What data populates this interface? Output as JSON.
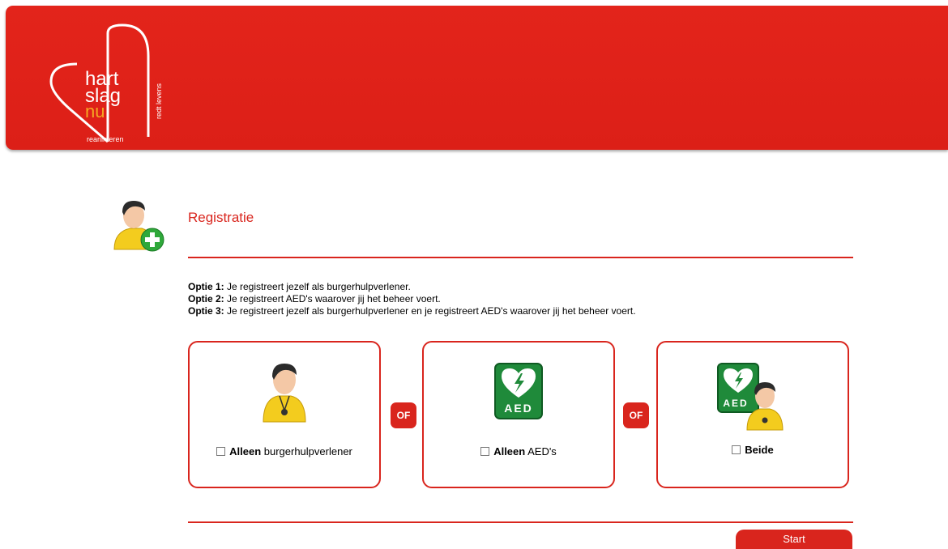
{
  "brand": {
    "logo_line1": "hart",
    "logo_line2": "slag",
    "logo_line3": "nu",
    "logo_sub": "reanimeren",
    "logo_side": "redt levens"
  },
  "page": {
    "title": "Registratie"
  },
  "options": [
    {
      "label": "Optie 1:",
      "text": " Je registreert jezelf als burgerhulpverlener."
    },
    {
      "label": "Optie 2:",
      "text": " Je registreert AED's waarover jij het beheer voert."
    },
    {
      "label": "Optie 3:",
      "text": " Je registreert jezelf als burgerhulpverlener en je registreert AED's waarover jij het beheer voert."
    }
  ],
  "cards": [
    {
      "bold": "Alleen",
      "rest": " burgerhulpverlener",
      "icon": "person-icon"
    },
    {
      "bold": "Alleen",
      "rest": " AED's",
      "icon": "aed-icon"
    },
    {
      "bold": "Beide",
      "rest": "",
      "icon": "aed-person-icon"
    }
  ],
  "separator": "OF",
  "aed_label": "AED",
  "start_label": "Start",
  "colors": {
    "brand_red": "#d9251d",
    "header_red": "#e3241b",
    "logo_orange": "#f5a623"
  }
}
